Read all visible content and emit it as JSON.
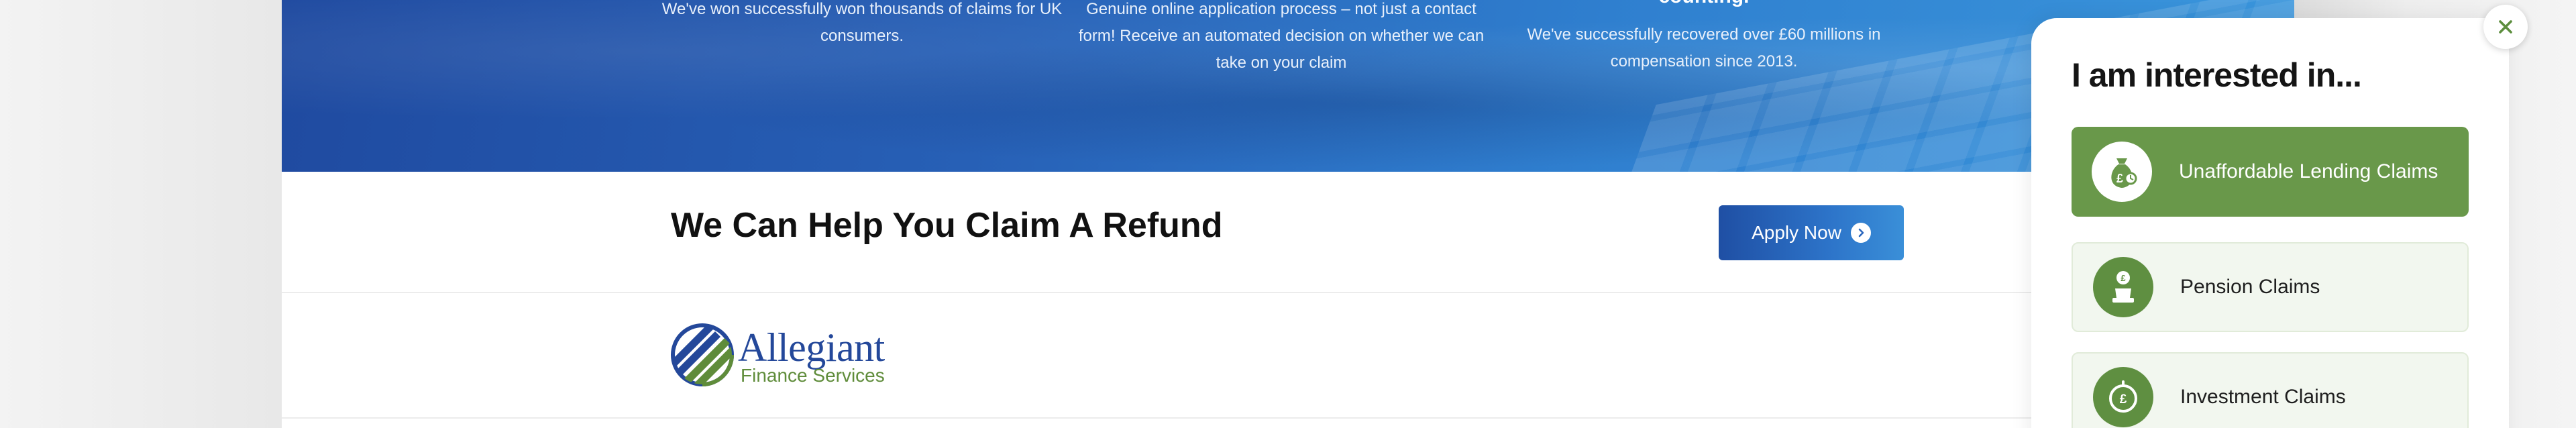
{
  "hero": {
    "col1_text": "We've won successfully won thousands of claims for UK consumers.",
    "col2_text": "Genuine online application process – not just a contact form! Receive an automated decision on whether we can take on your claim",
    "col3_heading": "counting.",
    "col3_text": "We've successfully recovered over £60 millions in compensation since 2013."
  },
  "refund": {
    "title": "We Can Help You Claim A Refund",
    "apply_label": "Apply Now"
  },
  "logo": {
    "name": "Allegiant",
    "subtitle": "Finance Services"
  },
  "panel": {
    "title": "I am interested in...",
    "options": [
      {
        "label": "Unaffordable Lending Claims",
        "icon": "money-bag-icon",
        "selected": true
      },
      {
        "label": "Pension Claims",
        "icon": "pension-icon",
        "selected": false
      },
      {
        "label": "Investment Claims",
        "icon": "pound-coin-icon",
        "selected": false
      }
    ]
  },
  "colors": {
    "hero_start": "#1f4aa0",
    "hero_end": "#3a96dc",
    "accent_green": "#69984a",
    "brand_blue": "#24489a"
  }
}
